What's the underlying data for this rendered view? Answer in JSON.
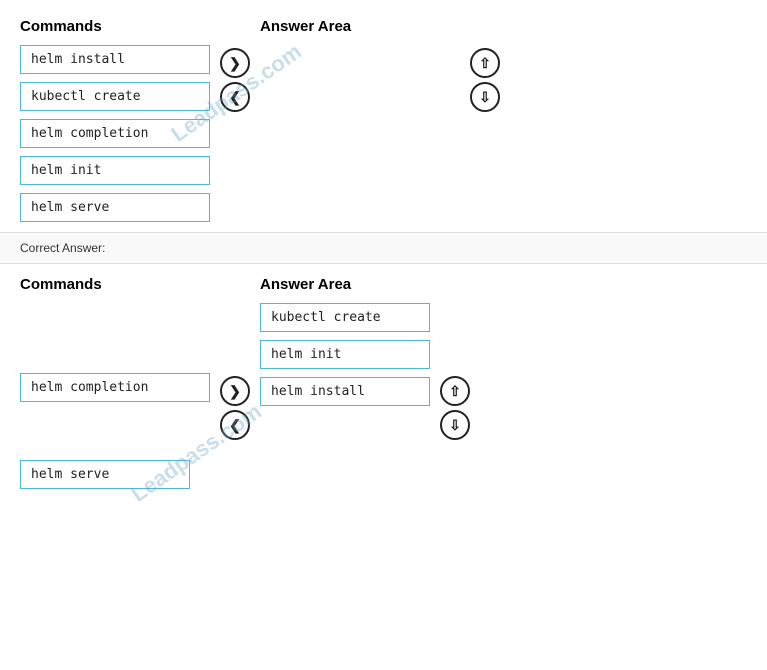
{
  "section1": {
    "commands_label": "Commands",
    "answer_area_label": "Answer Area",
    "commands": [
      {
        "text": "helm install"
      },
      {
        "text": "kubectl create"
      },
      {
        "text": "helm completion"
      },
      {
        "text": "helm init"
      },
      {
        "text": "helm serve"
      }
    ],
    "answer_items": []
  },
  "correct_answer_label": "Correct Answer:",
  "section2": {
    "commands_label": "Commands",
    "answer_area_label": "Answer Area",
    "commands": [
      {
        "text": "helm completion"
      },
      {
        "text": "helm serve"
      }
    ],
    "answer_items": [
      {
        "text": "kubectl create"
      },
      {
        "text": "helm init"
      },
      {
        "text": "helm install"
      }
    ]
  },
  "arrows": {
    "right": "❯",
    "left": "❮",
    "up": "⌃",
    "down": "⌄"
  }
}
